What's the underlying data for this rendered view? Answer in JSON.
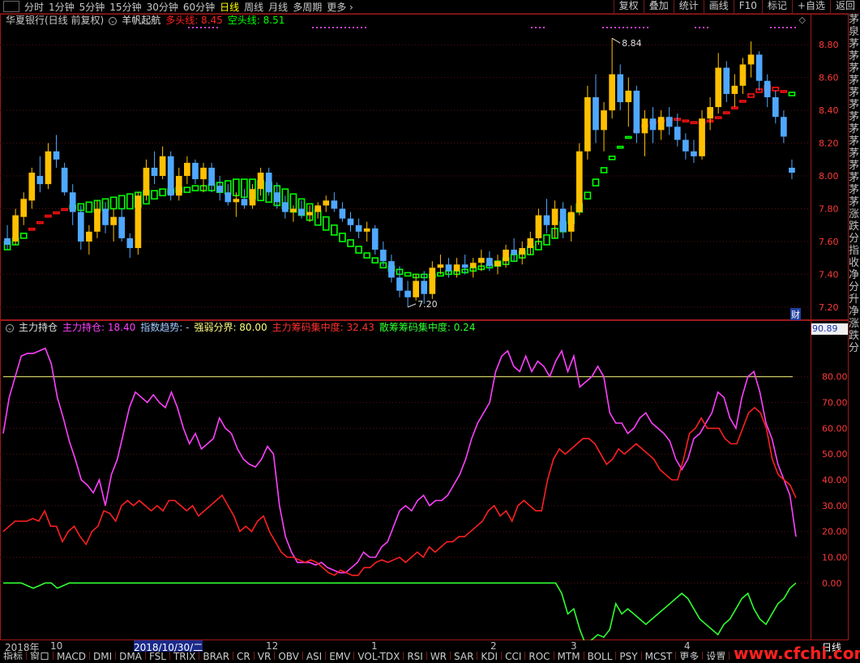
{
  "toolbar": {
    "periods": [
      "分时",
      "1分钟",
      "5分钟",
      "15分钟",
      "30分钟",
      "60分钟",
      "日线",
      "周线",
      "月线",
      "多周期",
      "更多 ›"
    ],
    "active_period": "日线",
    "right_buttons": [
      "复权",
      "叠加",
      "统计",
      "画线",
      "F10",
      "标记",
      "+自选",
      "返回"
    ]
  },
  "main_panel": {
    "stock_name": "华夏银行(日线 前复权)",
    "indicator_name": "羊帆起航",
    "bull_label": "多头线: 8.45",
    "bear_label": "空头线: 8.51",
    "high_marker": "8.84",
    "low_marker": "7.20",
    "fin_badge": "财",
    "colors": {
      "up": "#ffc000",
      "down": "#4fa8ff",
      "bull": "#ff1010",
      "bear": "#00ff00"
    }
  },
  "sub_panel": {
    "indicator_name": "主力持仓",
    "legend": [
      {
        "text": "主力持仓: 18.40",
        "color": "#ff40ff"
      },
      {
        "text": "指数趋势: -",
        "color": "#a0c8ff"
      },
      {
        "text": "强弱分界: 80.00",
        "color": "#ffff80"
      },
      {
        "text": "主力筹码集中度: 32.43",
        "color": "#ff3030"
      },
      {
        "text": "散筹筹码集中度: 0.24",
        "color": "#30ff30"
      }
    ],
    "current_value": "90.89"
  },
  "date_axis": {
    "labels": [
      "2018年",
      "10",
      "2018/10/30/二",
      "12",
      "1",
      "2",
      "3",
      "4"
    ],
    "period_label": "日线"
  },
  "right_strip_text": "茅泉茅茅茅茅茅茅茅茅茅茅茅茅茅茅涨跌分指收净分升净涨跌分",
  "bottom_tabs": [
    "指标",
    "窗口",
    "MACD",
    "DMI",
    "DMA",
    "FSL",
    "TRIX",
    "BRAR",
    "CR",
    "VR",
    "OBV",
    "ASI",
    "EMV",
    "VOL-TDX",
    "RSI",
    "WR",
    "SAR",
    "KDJ",
    "CCI",
    "ROC",
    "MTM",
    "BOLL",
    "PSY",
    "MCST",
    "更多",
    "设置"
  ],
  "watermark": "www.cfchi.com",
  "chart_data": [
    {
      "type": "candlestick",
      "title": "羊帆起航",
      "ylim": [
        7.15,
        8.9
      ],
      "yticks": [
        8.8,
        8.6,
        8.4,
        8.2,
        8.0,
        7.8,
        7.6,
        7.4,
        7.2
      ],
      "candles": [
        [
          7.62,
          7.7,
          7.55,
          7.58
        ],
        [
          7.6,
          7.8,
          7.58,
          7.76
        ],
        [
          7.75,
          7.9,
          7.7,
          7.86
        ],
        [
          7.85,
          8.05,
          7.8,
          8.02
        ],
        [
          8.0,
          8.12,
          7.9,
          7.95
        ],
        [
          7.95,
          8.2,
          7.92,
          8.15
        ],
        [
          8.15,
          8.25,
          8.05,
          8.1
        ],
        [
          8.05,
          8.08,
          7.88,
          7.9
        ],
        [
          7.9,
          7.95,
          7.7,
          7.78
        ],
        [
          7.78,
          7.82,
          7.55,
          7.6
        ],
        [
          7.6,
          7.7,
          7.52,
          7.66
        ],
        [
          7.66,
          7.85,
          7.62,
          7.8
        ],
        [
          7.8,
          7.84,
          7.65,
          7.7
        ],
        [
          7.7,
          7.8,
          7.6,
          7.75
        ],
        [
          7.75,
          7.8,
          7.6,
          7.62
        ],
        [
          7.62,
          7.65,
          7.5,
          7.56
        ],
        [
          7.56,
          7.9,
          7.52,
          7.88
        ],
        [
          7.88,
          8.1,
          7.85,
          8.05
        ],
        [
          8.05,
          8.15,
          7.95,
          8.0
        ],
        [
          8.0,
          8.18,
          7.98,
          8.12
        ],
        [
          8.12,
          8.15,
          7.85,
          7.88
        ],
        [
          7.88,
          8.05,
          7.85,
          8.0
        ],
        [
          8.0,
          8.12,
          7.95,
          8.08
        ],
        [
          8.08,
          8.1,
          7.95,
          7.98
        ],
        [
          7.98,
          8.08,
          7.9,
          8.05
        ],
        [
          8.05,
          8.08,
          7.9,
          7.94
        ],
        [
          7.94,
          8.0,
          7.85,
          7.9
        ],
        [
          7.9,
          7.95,
          7.82,
          7.84
        ],
        [
          7.84,
          7.9,
          7.75,
          7.86
        ],
        [
          7.86,
          7.92,
          7.8,
          7.82
        ],
        [
          7.82,
          7.95,
          7.8,
          7.92
        ],
        [
          7.92,
          8.05,
          7.88,
          8.02
        ],
        [
          8.02,
          8.05,
          7.88,
          7.9
        ],
        [
          7.9,
          7.96,
          7.8,
          7.84
        ],
        [
          7.84,
          7.88,
          7.74,
          7.78
        ],
        [
          7.78,
          7.82,
          7.72,
          7.8
        ],
        [
          7.8,
          7.85,
          7.74,
          7.76
        ],
        [
          7.76,
          7.82,
          7.72,
          7.78
        ],
        [
          7.78,
          7.84,
          7.74,
          7.82
        ],
        [
          7.82,
          7.88,
          7.78,
          7.85
        ],
        [
          7.85,
          7.9,
          7.78,
          7.8
        ],
        [
          7.8,
          7.84,
          7.72,
          7.74
        ],
        [
          7.74,
          7.78,
          7.66,
          7.7
        ],
        [
          7.7,
          7.74,
          7.62,
          7.66
        ],
        [
          7.66,
          7.72,
          7.6,
          7.68
        ],
        [
          7.68,
          7.7,
          7.52,
          7.55
        ],
        [
          7.55,
          7.6,
          7.45,
          7.48
        ],
        [
          7.48,
          7.52,
          7.35,
          7.38
        ],
        [
          7.38,
          7.45,
          7.26,
          7.3
        ],
        [
          7.3,
          7.36,
          7.2,
          7.26
        ],
        [
          7.26,
          7.4,
          7.24,
          7.36
        ],
        [
          7.36,
          7.42,
          7.22,
          7.28
        ],
        [
          7.28,
          7.48,
          7.25,
          7.44
        ],
        [
          7.44,
          7.52,
          7.4,
          7.46
        ],
        [
          7.46,
          7.5,
          7.38,
          7.42
        ],
        [
          7.42,
          7.5,
          7.38,
          7.46
        ],
        [
          7.46,
          7.52,
          7.4,
          7.44
        ],
        [
          7.44,
          7.5,
          7.38,
          7.47
        ],
        [
          7.47,
          7.55,
          7.42,
          7.5
        ],
        [
          7.5,
          7.54,
          7.42,
          7.45
        ],
        [
          7.45,
          7.52,
          7.4,
          7.48
        ],
        [
          7.48,
          7.58,
          7.44,
          7.55
        ],
        [
          7.55,
          7.62,
          7.48,
          7.52
        ],
        [
          7.52,
          7.6,
          7.46,
          7.56
        ],
        [
          7.56,
          7.66,
          7.52,
          7.62
        ],
        [
          7.62,
          7.8,
          7.58,
          7.76
        ],
        [
          7.76,
          7.86,
          7.65,
          7.7
        ],
        [
          7.7,
          7.85,
          7.62,
          7.8
        ],
        [
          7.8,
          7.84,
          7.62,
          7.66
        ],
        [
          7.66,
          7.82,
          7.6,
          7.78
        ],
        [
          7.78,
          8.2,
          7.76,
          8.15
        ],
        [
          8.15,
          8.55,
          8.1,
          8.48
        ],
        [
          8.48,
          8.62,
          8.2,
          8.28
        ],
        [
          8.28,
          8.45,
          8.15,
          8.4
        ],
        [
          8.4,
          8.84,
          8.35,
          8.62
        ],
        [
          8.62,
          8.68,
          8.4,
          8.45
        ],
        [
          8.45,
          8.6,
          8.3,
          8.52
        ],
        [
          8.52,
          8.55,
          8.2,
          8.26
        ],
        [
          8.26,
          8.4,
          8.12,
          8.35
        ],
        [
          8.35,
          8.42,
          8.2,
          8.28
        ],
        [
          8.28,
          8.4,
          8.22,
          8.36
        ],
        [
          8.36,
          8.42,
          8.25,
          8.3
        ],
        [
          8.3,
          8.38,
          8.18,
          8.22
        ],
        [
          8.22,
          8.26,
          8.1,
          8.15
        ],
        [
          8.15,
          8.22,
          8.08,
          8.12
        ],
        [
          8.12,
          8.4,
          8.1,
          8.35
        ],
        [
          8.35,
          8.48,
          8.28,
          8.42
        ],
        [
          8.42,
          8.75,
          8.38,
          8.66
        ],
        [
          8.66,
          8.7,
          8.45,
          8.5
        ],
        [
          8.5,
          8.62,
          8.42,
          8.55
        ],
        [
          8.55,
          8.72,
          8.5,
          8.68
        ],
        [
          8.68,
          8.82,
          8.6,
          8.74
        ],
        [
          8.74,
          8.76,
          8.52,
          8.58
        ],
        [
          8.58,
          8.62,
          8.42,
          8.48
        ],
        [
          8.48,
          8.52,
          8.32,
          8.36
        ],
        [
          8.36,
          8.4,
          8.2,
          8.24
        ],
        [
          8.05,
          8.1,
          7.98,
          8.02
        ]
      ],
      "bull_line": [
        7.55,
        7.58,
        7.62,
        7.68,
        7.72,
        7.76,
        7.78,
        7.8,
        7.8,
        7.79,
        7.78,
        7.78,
        7.79,
        7.8,
        7.8,
        7.8,
        7.81,
        7.83,
        7.86,
        7.88,
        7.89,
        7.9,
        7.9,
        7.91,
        7.91,
        7.91,
        7.9,
        7.89,
        7.88,
        7.87,
        7.86,
        7.85,
        7.84,
        7.82,
        7.8,
        7.78,
        7.76,
        7.73,
        7.7,
        7.67,
        7.64,
        7.6,
        7.57,
        7.53,
        7.5,
        7.47,
        7.44,
        7.42,
        7.4,
        7.39,
        7.38,
        7.38,
        7.38,
        7.39,
        7.4,
        7.4,
        7.41,
        7.42,
        7.43,
        7.44,
        7.45,
        7.46,
        7.48,
        7.5,
        7.52,
        7.55,
        7.58,
        7.62,
        7.66,
        7.71,
        7.78,
        7.86,
        7.94,
        8.02,
        8.1,
        8.17,
        8.23,
        8.28,
        8.31,
        8.33,
        8.34,
        8.35,
        8.35,
        8.34,
        8.33,
        8.33,
        8.34,
        8.36,
        8.39,
        8.42,
        8.46,
        8.5,
        8.53,
        8.55,
        8.54,
        8.52,
        8.49
      ],
      "bear_line": [
        7.6,
        7.62,
        7.65,
        7.68,
        7.72,
        7.75,
        7.78,
        7.8,
        7.82,
        7.83,
        7.84,
        7.85,
        7.86,
        7.87,
        7.88,
        7.89,
        7.9,
        7.91,
        7.91,
        7.92,
        7.92,
        7.93,
        7.93,
        7.94,
        7.94,
        7.95,
        7.96,
        7.97,
        7.98,
        7.98,
        7.98,
        7.97,
        7.96,
        7.94,
        7.92,
        7.89,
        7.86,
        7.83,
        7.79,
        7.75,
        7.7,
        7.65,
        7.61,
        7.57,
        7.53,
        7.5,
        7.47,
        7.45,
        7.43,
        7.41,
        7.4,
        7.4,
        7.4,
        7.41,
        7.42,
        7.42,
        7.43,
        7.44,
        7.45,
        7.46,
        7.48,
        7.5,
        7.52,
        7.54,
        7.57,
        7.6,
        7.64,
        7.68,
        7.72,
        7.77,
        7.83,
        7.9,
        7.98,
        8.05,
        8.12,
        8.18,
        8.24,
        8.28,
        8.31,
        8.33,
        8.34,
        8.34,
        8.34,
        8.33,
        8.32,
        8.32,
        8.33,
        8.35,
        8.38,
        8.41,
        8.45,
        8.48,
        8.51,
        8.52,
        8.52,
        8.51,
        8.51
      ]
    },
    {
      "type": "line",
      "title": "主力持仓",
      "ylim": [
        -20,
        95
      ],
      "yticks": [
        80.0,
        70.0,
        60.0,
        50.0,
        40.0,
        30.0,
        20.0,
        10.0,
        0.0
      ],
      "threshold": 80.0,
      "series": [
        {
          "name": "主力持仓",
          "color": "#ff40ff",
          "values": [
            58,
            72,
            80,
            88,
            89,
            89,
            90,
            91,
            85,
            72,
            64,
            55,
            48,
            40,
            38,
            35,
            40,
            30,
            42,
            48,
            58,
            68,
            74,
            72,
            70,
            73,
            70,
            68,
            74,
            68,
            60,
            54,
            58,
            52,
            54,
            56,
            64,
            60,
            58,
            52,
            48,
            46,
            45,
            48,
            53,
            50,
            30,
            18,
            12,
            8,
            8,
            8,
            7,
            8,
            6,
            5,
            4,
            4,
            6,
            8,
            12,
            10,
            10,
            14,
            16,
            22,
            28,
            30,
            28,
            32,
            34,
            30,
            32,
            32,
            34,
            38,
            42,
            48,
            56,
            62,
            66,
            70,
            82,
            88,
            90,
            84,
            82,
            88,
            82,
            86,
            84,
            80,
            86,
            90,
            82,
            88,
            76,
            78,
            80,
            84,
            80,
            66,
            62,
            62,
            58,
            60,
            64,
            66,
            62,
            60,
            58,
            55,
            48,
            44,
            48,
            56,
            58,
            62,
            66,
            74,
            72,
            64,
            60,
            72,
            80,
            82,
            74,
            62,
            56,
            46,
            40,
            34,
            18
          ]
        },
        {
          "name": "主力筹码集中度",
          "color": "#ff2020",
          "values": [
            20,
            22,
            24,
            24,
            24,
            25,
            24,
            28,
            22,
            22,
            16,
            20,
            22,
            18,
            15,
            20,
            22,
            28,
            27,
            24,
            30,
            32,
            30,
            32,
            30,
            28,
            30,
            28,
            32,
            32,
            30,
            28,
            30,
            26,
            28,
            30,
            32,
            34,
            30,
            26,
            20,
            22,
            20,
            24,
            26,
            20,
            16,
            12,
            10,
            10,
            9,
            8,
            9,
            8,
            6,
            4,
            3,
            5,
            4,
            3,
            3,
            6,
            6,
            8,
            9,
            8,
            9,
            10,
            8,
            10,
            12,
            10,
            14,
            12,
            14,
            16,
            16,
            18,
            18,
            20,
            22,
            24,
            28,
            30,
            26,
            28,
            24,
            30,
            32,
            30,
            28,
            28,
            40,
            48,
            52,
            50,
            52,
            54,
            56,
            56,
            54,
            50,
            46,
            48,
            52,
            50,
            52,
            54,
            52,
            50,
            48,
            44,
            42,
            40,
            40,
            48,
            58,
            60,
            64,
            60,
            60,
            60,
            56,
            54,
            54,
            60,
            66,
            68,
            66,
            60,
            48,
            42,
            40,
            38,
            33
          ]
        },
        {
          "name": "散筹筹码集中度",
          "color": "#30ff30",
          "values": [
            0,
            0,
            0,
            0,
            -1,
            -2,
            -1,
            0,
            0,
            -2,
            -1,
            0,
            0,
            0,
            0,
            0,
            0,
            0,
            0,
            0,
            0,
            0,
            0,
            0,
            0,
            0,
            0,
            0,
            0,
            0,
            0,
            0,
            0,
            0,
            0,
            0,
            0,
            0,
            0,
            0,
            0,
            0,
            0,
            0,
            0,
            0,
            0,
            0,
            0,
            0,
            0,
            0,
            0,
            0,
            0,
            0,
            0,
            0,
            0,
            0,
            0,
            0,
            0,
            0,
            0,
            0,
            0,
            0,
            0,
            0,
            0,
            0,
            0,
            0,
            0,
            0,
            0,
            0,
            0,
            0,
            0,
            0,
            0,
            0,
            0,
            0,
            0,
            0,
            0,
            0,
            0,
            0,
            0,
            -4,
            -12,
            -10,
            -18,
            -24,
            -22,
            -20,
            -21,
            -18,
            -8,
            -12,
            -10,
            -12,
            -14,
            -16,
            -14,
            -12,
            -10,
            -8,
            -6,
            -4,
            -6,
            -10,
            -14,
            -16,
            -18,
            -20,
            -16,
            -14,
            -10,
            -6,
            -4,
            -10,
            -14,
            -16,
            -12,
            -8,
            -6,
            -2,
            0
          ]
        }
      ]
    }
  ]
}
